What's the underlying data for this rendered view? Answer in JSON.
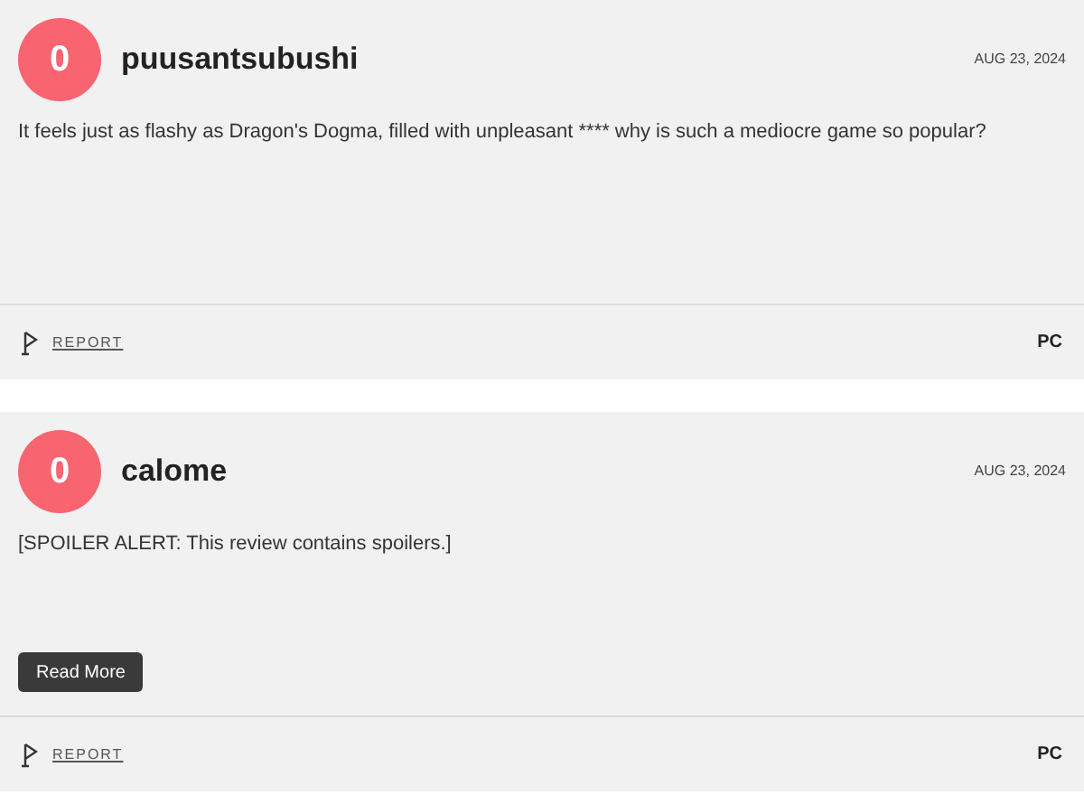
{
  "reviews": [
    {
      "avatar": "0",
      "username": "puusantsubushi",
      "date": "AUG 23, 2024",
      "body": "It feels just as flashy as Dragon's Dogma, filled with unpleasant **** why is such a mediocre game so popular?",
      "report": "REPORT",
      "platform": "PC"
    },
    {
      "avatar": "0",
      "username": "calome",
      "date": "AUG 23, 2024",
      "body": "[SPOILER ALERT: This review contains spoilers.]",
      "button": "Read More",
      "report": "REPORT",
      "platform": "PC"
    }
  ]
}
